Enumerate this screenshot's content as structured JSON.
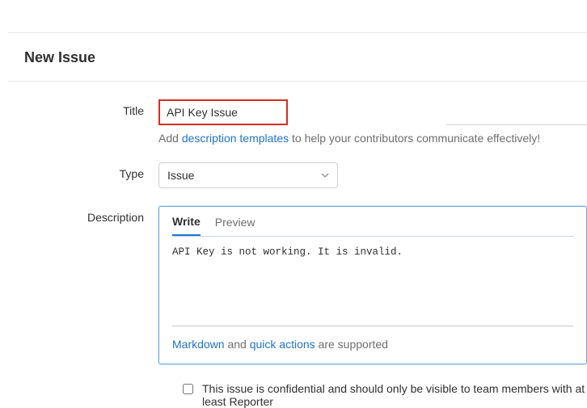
{
  "page": {
    "heading": "New Issue"
  },
  "form": {
    "title": {
      "label": "Title",
      "value": "API Key Issue"
    },
    "title_hint": {
      "pre": "Add ",
      "link": "description templates",
      "post": " to help your contributors communicate effectively!"
    },
    "type": {
      "label": "Type",
      "selected": "Issue"
    },
    "description": {
      "label": "Description",
      "tabs": {
        "write": "Write",
        "preview": "Preview"
      },
      "content": "API Key is not working. It is invalid.",
      "footer": {
        "link1": "Markdown",
        "mid": " and ",
        "link2": "quick actions",
        "post": " are supported"
      }
    },
    "confidential": {
      "checked": false,
      "text": "This issue is confidential and should only be visible to team members with at least Reporter"
    }
  }
}
